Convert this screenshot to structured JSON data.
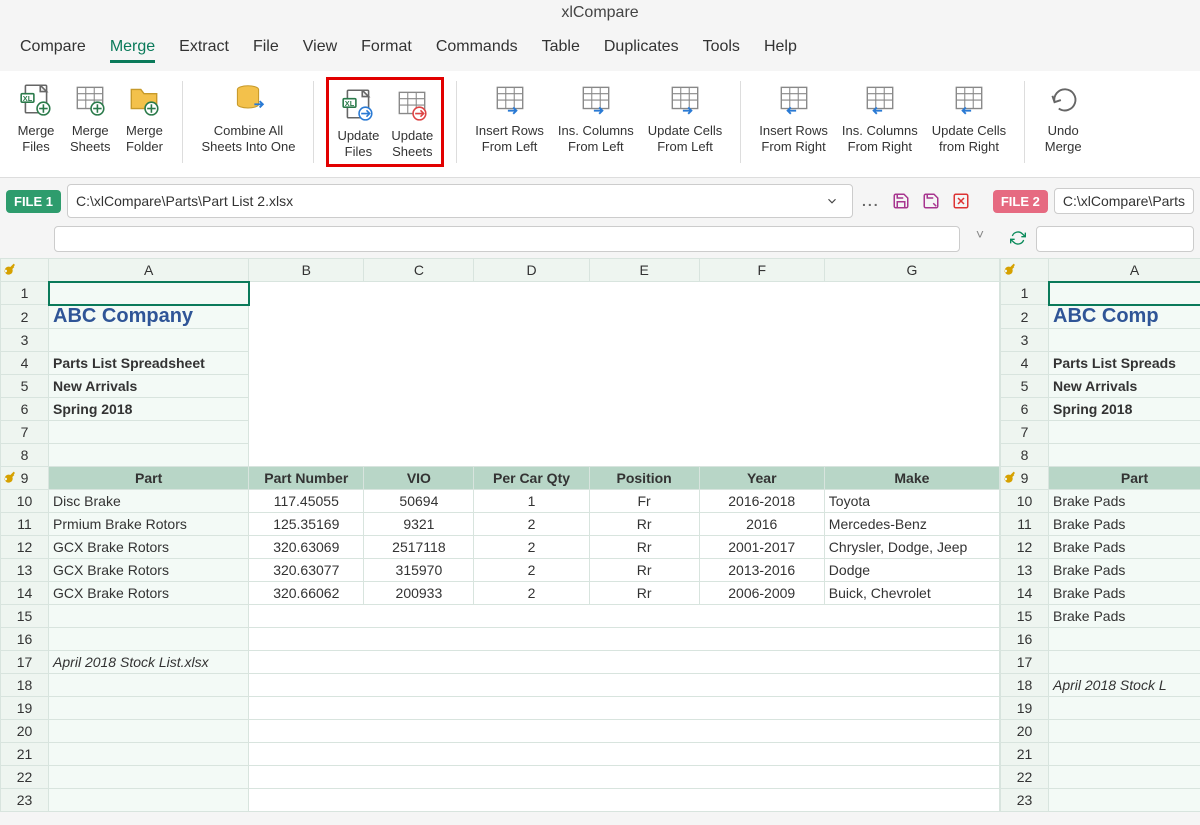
{
  "app_title": "xlCompare",
  "menu": [
    "Compare",
    "Merge",
    "Extract",
    "File",
    "View",
    "Format",
    "Commands",
    "Table",
    "Duplicates",
    "Tools",
    "Help"
  ],
  "menu_active_index": 1,
  "ribbon": [
    {
      "name": "merge-files",
      "label": "Merge\nFiles"
    },
    {
      "name": "merge-sheets",
      "label": "Merge\nSheets"
    },
    {
      "name": "merge-folder",
      "label": "Merge\nFolder"
    },
    {
      "sep": true
    },
    {
      "name": "combine-all",
      "label": "Combine All\nSheets Into One"
    },
    {
      "sep": true
    },
    {
      "name": "update-files",
      "label": "Update\nFiles",
      "hl": true
    },
    {
      "name": "update-sheets",
      "label": "Update\nSheets",
      "hl": true
    },
    {
      "sep": true
    },
    {
      "name": "insert-rows-left",
      "label": "Insert Rows\nFrom Left",
      "gray": true
    },
    {
      "name": "ins-columns-left",
      "label": "Ins. Columns\nFrom Left",
      "gray": true
    },
    {
      "name": "update-cells-left",
      "label": "Update Cells\nFrom Left",
      "gray": true
    },
    {
      "sep": true
    },
    {
      "name": "insert-rows-right",
      "label": "Insert Rows\nFrom Right",
      "gray": true
    },
    {
      "name": "ins-columns-right",
      "label": "Ins. Columns\nFrom Right",
      "gray": true
    },
    {
      "name": "update-cells-right",
      "label": "Update Cells\nfrom Right",
      "gray": true
    },
    {
      "sep": true
    },
    {
      "name": "undo-merge",
      "label": "Undo\nMerge"
    }
  ],
  "file1": {
    "tag": "FILE 1",
    "path": "C:\\xlCompare\\Parts\\Part List 2.xlsx"
  },
  "file2": {
    "tag": "FILE 2",
    "path": "C:\\xlCompare\\Parts"
  },
  "cols": [
    "A",
    "B",
    "C",
    "D",
    "E",
    "F",
    "G"
  ],
  "sheet": {
    "title": "ABC Company",
    "subtitle1": "Parts List Spreadsheet",
    "subtitle2": "New Arrivals",
    "subtitle3": "Spring 2018",
    "headers": [
      "Part",
      "Part Number",
      "VIO",
      "Per Car Qty",
      "Position",
      "Year",
      "Make"
    ],
    "rows": [
      [
        "Disc Brake",
        "117.45055",
        "50694",
        "1",
        "Fr",
        "2016-2018",
        "Toyota"
      ],
      [
        "Prmium Brake Rotors",
        "125.35169",
        "9321",
        "2",
        "Rr",
        "2016",
        "Mercedes-Benz"
      ],
      [
        "GCX Brake Rotors",
        "320.63069",
        "2517118",
        "2",
        "Rr",
        "2001-2017",
        "Chrysler, Dodge, Jeep"
      ],
      [
        "GCX Brake Rotors",
        "320.63077",
        "315970",
        "2",
        "Rr",
        "2013-2016",
        "Dodge"
      ],
      [
        "GCX Brake Rotors",
        "320.66062",
        "200933",
        "2",
        "Rr",
        "2006-2009",
        "Buick, Chevrolet"
      ]
    ],
    "footer": "April 2018 Stock List.xlsx"
  },
  "sheet2": {
    "title": "ABC Comp",
    "subtitle1": "Parts List Spreads",
    "subtitle2": "New Arrivals",
    "subtitle3": "Spring 2018",
    "header": "Part",
    "rows": [
      "Brake Pads",
      "Brake Pads",
      "Brake Pads",
      "Brake Pads",
      "Brake Pads",
      "Brake Pads"
    ],
    "footer": "April 2018 Stock L"
  }
}
